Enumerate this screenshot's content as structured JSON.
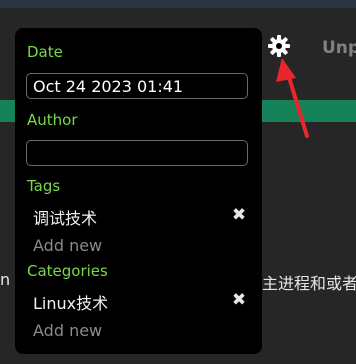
{
  "background": {
    "header_text": "Unp",
    "text_left": "n",
    "text_right": "主进程和或者"
  },
  "popup": {
    "date_label": "Date",
    "date_value": "Oct 24 2023 01:41",
    "author_label": "Author",
    "author_value": "",
    "tags_label": "Tags",
    "tags": [
      "调试技术"
    ],
    "tags_add": "Add new",
    "categories_label": "Categories",
    "categories": [
      "Linux技术"
    ],
    "categories_add": "Add new",
    "remove_glyph": "✖"
  },
  "icons": {
    "settings": "gear-icon",
    "annotation": "red-arrow-icon"
  },
  "colors": {
    "label_green": "#79d947",
    "popup_bg": "#000000",
    "page_bg": "#262626",
    "green_band": "#16825a",
    "arrow_red": "#e8262b"
  }
}
